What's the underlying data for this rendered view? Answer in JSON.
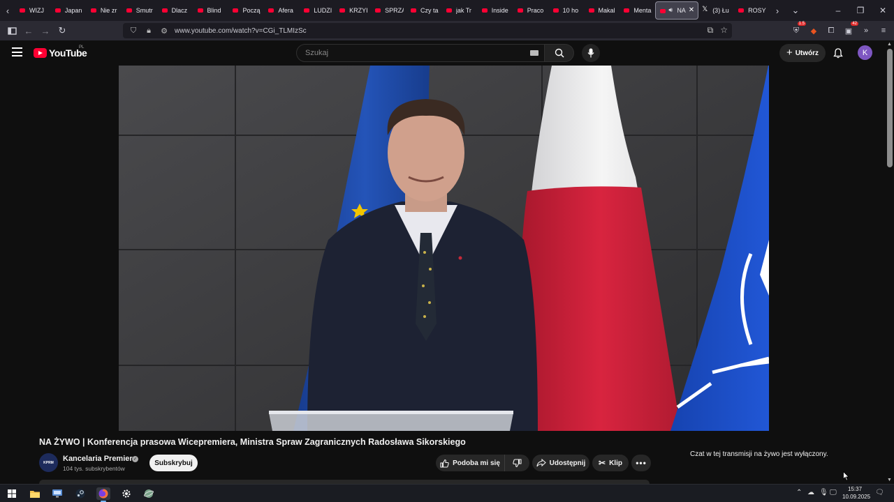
{
  "browser": {
    "tabs": [
      {
        "label": "WIZJ",
        "favicon": "youtube-icon"
      },
      {
        "label": "Japan",
        "favicon": "youtube-icon"
      },
      {
        "label": "Nie zr",
        "favicon": "youtube-icon"
      },
      {
        "label": "Smutr",
        "favicon": "youtube-icon"
      },
      {
        "label": "Dlacz",
        "favicon": "youtube-icon"
      },
      {
        "label": "Blind",
        "favicon": "youtube-icon"
      },
      {
        "label": "Począ",
        "favicon": "youtube-icon"
      },
      {
        "label": "Afera",
        "favicon": "youtube-icon"
      },
      {
        "label": "LUDZI",
        "favicon": "youtube-icon"
      },
      {
        "label": "KRZYI",
        "favicon": "youtube-icon"
      },
      {
        "label": "SPRZA",
        "favicon": "youtube-icon"
      },
      {
        "label": "Czy ta",
        "favicon": "youtube-icon"
      },
      {
        "label": "jak Tr",
        "favicon": "youtube-icon"
      },
      {
        "label": "Inside",
        "favicon": "youtube-icon"
      },
      {
        "label": "Praco",
        "favicon": "youtube-icon"
      },
      {
        "label": "10 ho",
        "favicon": "youtube-icon"
      },
      {
        "label": "Makal",
        "favicon": "youtube-icon"
      },
      {
        "label": "Menta",
        "favicon": "youtube-icon"
      },
      {
        "label": "NA",
        "favicon": "youtube-icon",
        "active": true
      },
      {
        "label": "(3) Łu",
        "favicon": "x-icon"
      },
      {
        "label": "ROSY",
        "favicon": "youtube-icon"
      }
    ],
    "url": "www.youtube.com/watch?v=CGi_TLMIzSc",
    "extension_badges": {
      "shield": "1.5",
      "extension": "42"
    }
  },
  "youtube": {
    "logo_text": "YouTube",
    "region": "PL",
    "search_placeholder": "Szukaj",
    "create_label": "Utwórz",
    "avatar_letter": "K"
  },
  "video": {
    "title": "NA ŻYWO | Konferencja prasowa Wicepremiera, Ministra Spraw Zagranicznych Radosława Sikorskiego",
    "channel_name": "Kancelaria Premiera",
    "channel_avatar_text": "KPRM",
    "subscribers": "104 tys. subskrybentów",
    "subscribe_label": "Subskrybuj",
    "like_label": "Podoba mi się",
    "share_label": "Udostępnij",
    "clip_label": "Klip",
    "chat_disabled_text": "Czat w tej transmisji na żywo jest wyłączony."
  },
  "taskbar": {
    "time": "15:37",
    "date": "10.09.2025"
  },
  "colors": {
    "youtube_red": "#ff0033",
    "background": "#0f0f0f",
    "avatar": "#7e57c2",
    "eu_blue": "#1f4fb0",
    "poland_red": "#d4213d",
    "nato_blue": "#1d4fc9"
  }
}
